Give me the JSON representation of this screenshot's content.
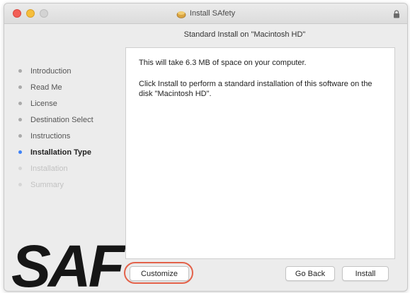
{
  "window": {
    "title": "Install SAfety",
    "lock_icon": "lock-icon",
    "package_icon": "package-icon"
  },
  "header": {
    "subtitle": "Standard Install on \"Macintosh HD\""
  },
  "sidebar": {
    "items": [
      {
        "label": "Introduction",
        "state": "done"
      },
      {
        "label": "Read Me",
        "state": "done"
      },
      {
        "label": "License",
        "state": "done"
      },
      {
        "label": "Destination Select",
        "state": "done"
      },
      {
        "label": "Instructions",
        "state": "done"
      },
      {
        "label": "Installation Type",
        "state": "active"
      },
      {
        "label": "Installation",
        "state": "pending"
      },
      {
        "label": "Summary",
        "state": "pending"
      }
    ],
    "logo_text": "SAF"
  },
  "content": {
    "line1": "This will take 6.3 MB of space on your computer.",
    "line2": "Click Install to perform a standard installation of this software on the disk \"Macintosh HD\"."
  },
  "buttons": {
    "customize": "Customize",
    "go_back": "Go Back",
    "install": "Install"
  },
  "colors": {
    "accent": "#3e82f7",
    "highlight": "#e3624a",
    "close": "#f25f57",
    "minimize": "#f6be3b"
  }
}
